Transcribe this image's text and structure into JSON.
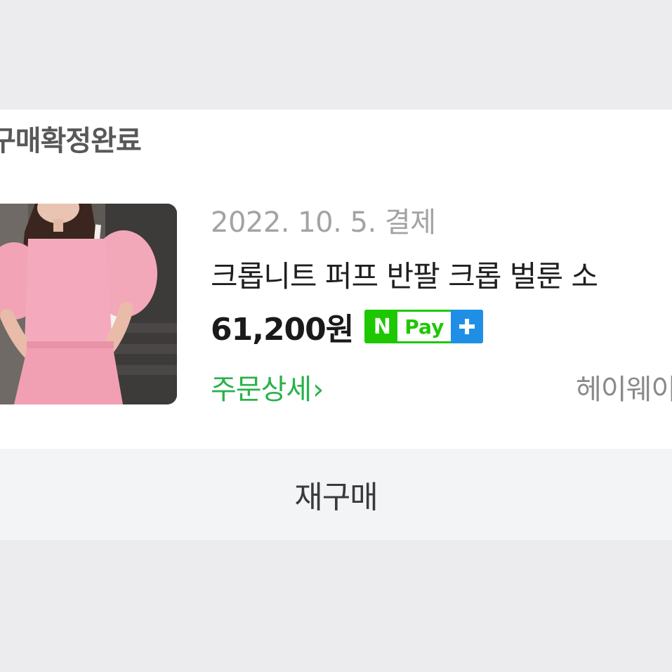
{
  "order": {
    "status": "구매확정완료",
    "date": "2022. 10. 5. 결제",
    "product_name": "크롭니트 퍼프 반팔 크롭 벌룬 소",
    "price": "61,200원",
    "npay": {
      "n_label": "N",
      "pay_label": "Pay",
      "plus_label": "+"
    },
    "detail_link": "주문상세",
    "detail_chevron": "›",
    "seller": "헤이웨이"
  },
  "actions": {
    "rebuy_label": "재구매"
  },
  "colors": {
    "brand_green": "#1ec800",
    "link_green": "#27b24a",
    "plus_blue": "#1f8fe5"
  },
  "icons": {
    "product_thumbnail": "pink-puff-sleeve-knit-photo",
    "chevron": "chevron-right-icon"
  }
}
